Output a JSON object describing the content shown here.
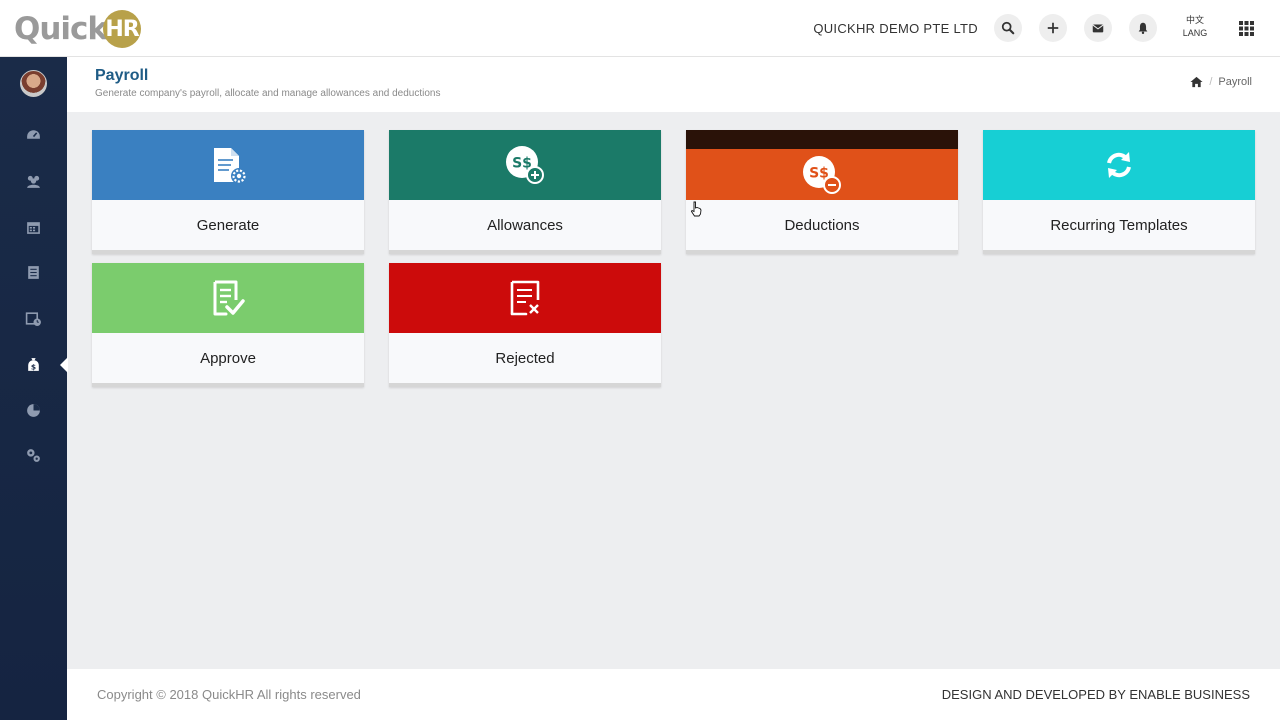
{
  "header": {
    "logo_text": "Quick",
    "logo_badge": "HR",
    "company": "QUICKHR DEMO PTE LTD",
    "buttons": [
      {
        "name": "search",
        "icon": "search-icon"
      },
      {
        "name": "add",
        "icon": "plus-icon"
      },
      {
        "name": "messages",
        "icon": "envelope-icon"
      },
      {
        "name": "notifications",
        "icon": "bell-icon"
      }
    ],
    "lang_top": "中文",
    "lang_bottom": "LANG",
    "apps_icon": "grid-icon"
  },
  "sidebar": {
    "items": [
      {
        "icon": "dashboard-icon"
      },
      {
        "icon": "users-icon"
      },
      {
        "icon": "calendar-icon"
      },
      {
        "icon": "document-icon"
      },
      {
        "icon": "calendar-clock-icon"
      },
      {
        "icon": "payroll-icon",
        "active": true
      },
      {
        "icon": "pie-chart-icon"
      },
      {
        "icon": "settings-icon"
      }
    ]
  },
  "page": {
    "title": "Payroll",
    "subtitle": "Generate company's payroll, allocate and manage allowances and deductions",
    "breadcrumb": "Payroll"
  },
  "cards": [
    {
      "label": "Generate",
      "color": "#3a80c1",
      "icon": "document-gear-icon"
    },
    {
      "label": "Allowances",
      "color": "#1b7a68",
      "icon": "money-plus-icon"
    },
    {
      "label": "Deductions",
      "color": "#e05119",
      "icon": "money-minus-icon"
    },
    {
      "label": "Recurring Templates",
      "color": "#17cfd4",
      "icon": "refresh-icon"
    },
    {
      "label": "Approve",
      "color": "#7bcc6d",
      "icon": "document-check-icon"
    },
    {
      "label": "Rejected",
      "color": "#cc0b0b",
      "icon": "document-x-icon"
    }
  ],
  "money_symbol": "S$",
  "footer": {
    "copyright": "Copyright © 2018 QuickHR All rights reserved",
    "credit": "DESIGN AND DEVELOPED BY ENABLE BUSINESS"
  }
}
